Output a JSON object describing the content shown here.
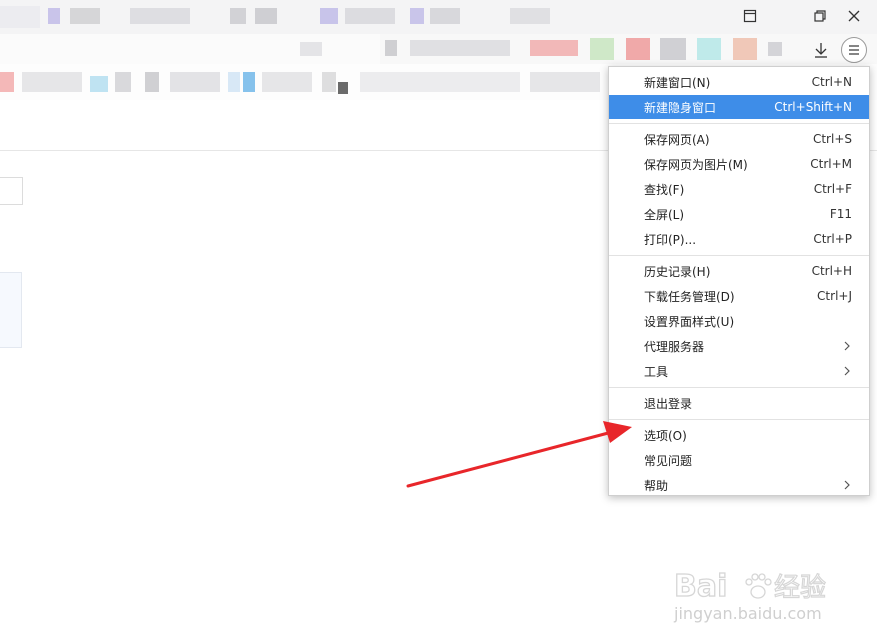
{
  "colors": {
    "highlight": "#3e8de8",
    "arrow": "#e8262a",
    "menu_border": "#cfcfcf"
  },
  "icons": {
    "minimize": "sidebar-toggle-icon",
    "restore": "restore-window-icon",
    "close": "close-icon",
    "download": "download-icon",
    "menu": "hamburger-menu-icon"
  },
  "menu": {
    "groups": [
      [
        {
          "label": "新建窗口(N)",
          "shortcut": "Ctrl+N"
        },
        {
          "label": "新建隐身窗口",
          "shortcut": "Ctrl+Shift+N",
          "highlighted": true
        }
      ],
      [
        {
          "label": "保存网页(A)",
          "shortcut": "Ctrl+S"
        },
        {
          "label": "保存网页为图片(M)",
          "shortcut": "Ctrl+M"
        },
        {
          "label": "查找(F)",
          "shortcut": "Ctrl+F"
        },
        {
          "label": "全屏(L)",
          "shortcut": "F11"
        },
        {
          "label": "打印(P)...",
          "shortcut": "Ctrl+P"
        }
      ],
      [
        {
          "label": "历史记录(H)",
          "shortcut": "Ctrl+H"
        },
        {
          "label": "下载任务管理(D)",
          "shortcut": "Ctrl+J"
        },
        {
          "label": "设置界面样式(U)",
          "shortcut": ""
        },
        {
          "label": "代理服务器",
          "shortcut": "",
          "submenu": true
        },
        {
          "label": "工具",
          "shortcut": "",
          "submenu": true
        }
      ],
      [
        {
          "label": "退出登录",
          "shortcut": ""
        }
      ],
      [
        {
          "label": "选项(O)",
          "shortcut": ""
        },
        {
          "label": "常见问题",
          "shortcut": ""
        },
        {
          "label": "帮助",
          "shortcut": "",
          "submenu": true
        }
      ]
    ]
  },
  "watermark": {
    "brand": "Bai",
    "brand2": "经验",
    "url": "jingyan.baidu.com"
  }
}
